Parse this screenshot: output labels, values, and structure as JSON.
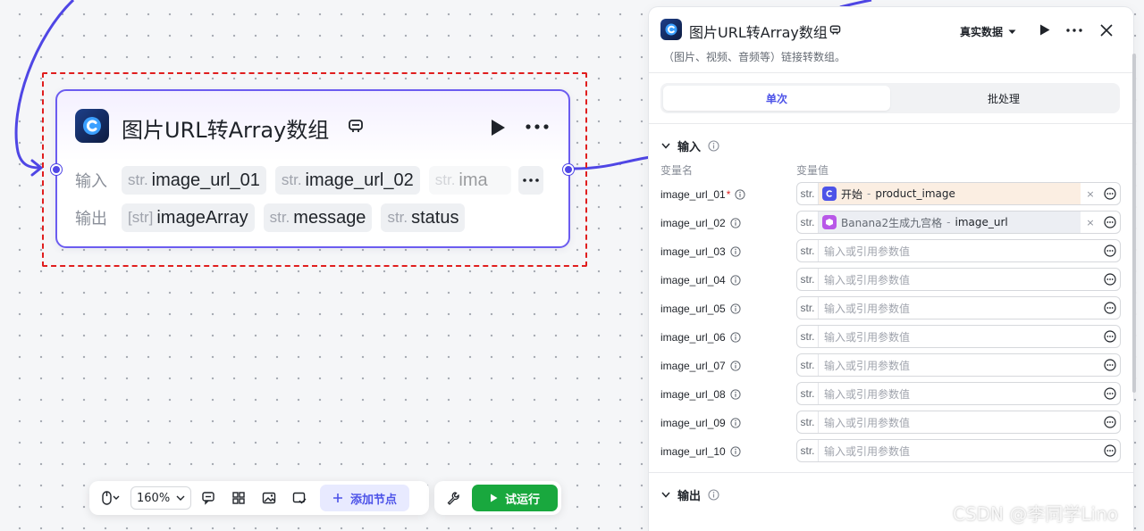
{
  "node": {
    "title": "图片URL转Array数组",
    "input_label": "输入",
    "output_label": "输出",
    "inputs": [
      {
        "type": "str.",
        "name": "image_url_01"
      },
      {
        "type": "str.",
        "name": "image_url_02"
      },
      {
        "type": "str.",
        "name": "ima"
      }
    ],
    "outputs": [
      {
        "type": "[str]",
        "name": "imageArray"
      },
      {
        "type": "str.",
        "name": "message"
      },
      {
        "type": "str.",
        "name": "status"
      }
    ],
    "more_label": "···"
  },
  "toolbar": {
    "zoom": "160%",
    "add_node_label": "添加节点",
    "try_run_label": "试运行"
  },
  "panel": {
    "title": "图片URL转Array数组",
    "description": "（图片、视频、音频等）链接转数组。",
    "data_mode": "真实数据",
    "tabs": [
      {
        "label": "单次",
        "active": true
      },
      {
        "label": "批处理",
        "active": false
      }
    ],
    "input_section": "输入",
    "output_section": "输出",
    "col_name": "变量名",
    "col_value": "变量值",
    "placeholder": "输入或引用参数值",
    "variables": [
      {
        "name": "image_url_01",
        "required": "*",
        "type": "str.",
        "ref_kind": "start",
        "ref_source": "开始",
        "ref_sep": "-",
        "ref_field": "product_image"
      },
      {
        "name": "image_url_02",
        "required": "",
        "type": "str.",
        "ref_kind": "banana",
        "ref_source": "Banana2生成九宫格",
        "ref_sep": "-",
        "ref_field": "image_url"
      },
      {
        "name": "image_url_03",
        "required": "",
        "type": "str."
      },
      {
        "name": "image_url_04",
        "required": "",
        "type": "str."
      },
      {
        "name": "image_url_05",
        "required": "",
        "type": "str."
      },
      {
        "name": "image_url_06",
        "required": "",
        "type": "str."
      },
      {
        "name": "image_url_07",
        "required": "",
        "type": "str."
      },
      {
        "name": "image_url_08",
        "required": "",
        "type": "str."
      },
      {
        "name": "image_url_09",
        "required": "",
        "type": "str."
      },
      {
        "name": "image_url_10",
        "required": "",
        "type": "str."
      }
    ],
    "clear_glyph": "×"
  },
  "watermark": "CSDN @李同学Lino",
  "colors": {
    "accent": "#4d53e8",
    "node_border": "#6b5cf0",
    "selection": "#e01e1e",
    "run_green": "#19a83e",
    "start_ref_bg": "#fbeee2"
  },
  "icons": [
    "chip-c-logo-icon",
    "copy-icon",
    "play-icon",
    "more-icon",
    "close-icon",
    "info-icon",
    "chevron-down-icon",
    "mouse-icon",
    "comment-icon",
    "grid-icon",
    "image-icon",
    "check-doc-icon",
    "plus-icon",
    "wrench-icon",
    "select-ref-icon"
  ]
}
